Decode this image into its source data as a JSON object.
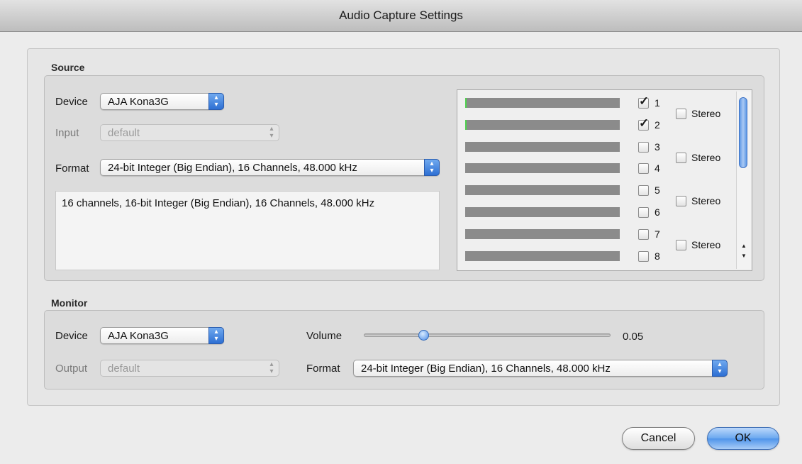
{
  "window": {
    "title": "Audio Capture Settings"
  },
  "source": {
    "group_label": "Source",
    "device_label": "Device",
    "device_value": "AJA Kona3G",
    "input_label": "Input",
    "input_value": "default",
    "format_label": "Format",
    "format_value": "24-bit Integer (Big Endian), 16 Channels, 48.000 kHz",
    "description": "16 channels, 16-bit Integer (Big Endian), 16 Channels, 48.000 kHz",
    "channels": [
      {
        "number": "1",
        "checked": true,
        "level": 0.01
      },
      {
        "number": "2",
        "checked": true,
        "level": 0.01
      },
      {
        "number": "3",
        "checked": false,
        "level": 0
      },
      {
        "number": "4",
        "checked": false,
        "level": 0
      },
      {
        "number": "5",
        "checked": false,
        "level": 0
      },
      {
        "number": "6",
        "checked": false,
        "level": 0
      },
      {
        "number": "7",
        "checked": false,
        "level": 0
      },
      {
        "number": "8",
        "checked": false,
        "level": 0
      }
    ],
    "stereo_pairs": [
      {
        "label": "Stereo",
        "checked": false
      },
      {
        "label": "Stereo",
        "checked": false
      },
      {
        "label": "Stereo",
        "checked": false
      },
      {
        "label": "Stereo",
        "checked": false
      }
    ]
  },
  "monitor": {
    "group_label": "Monitor",
    "device_label": "Device",
    "device_value": "AJA Kona3G",
    "output_label": "Output",
    "output_value": "default",
    "volume_label": "Volume",
    "volume_value": "0.05",
    "volume_fraction": 0.24,
    "format_label": "Format",
    "format_value": "24-bit Integer (Big Endian), 16 Channels, 48.000 kHz"
  },
  "buttons": {
    "cancel": "Cancel",
    "ok": "OK"
  },
  "colors": {
    "accent": "#4e93ea",
    "meter_level": "#4fd34f",
    "meter_bg": "#8b8b8b"
  },
  "icons": {
    "checkmark": "check-icon",
    "popup_arrows": "updown-arrows-icon"
  }
}
